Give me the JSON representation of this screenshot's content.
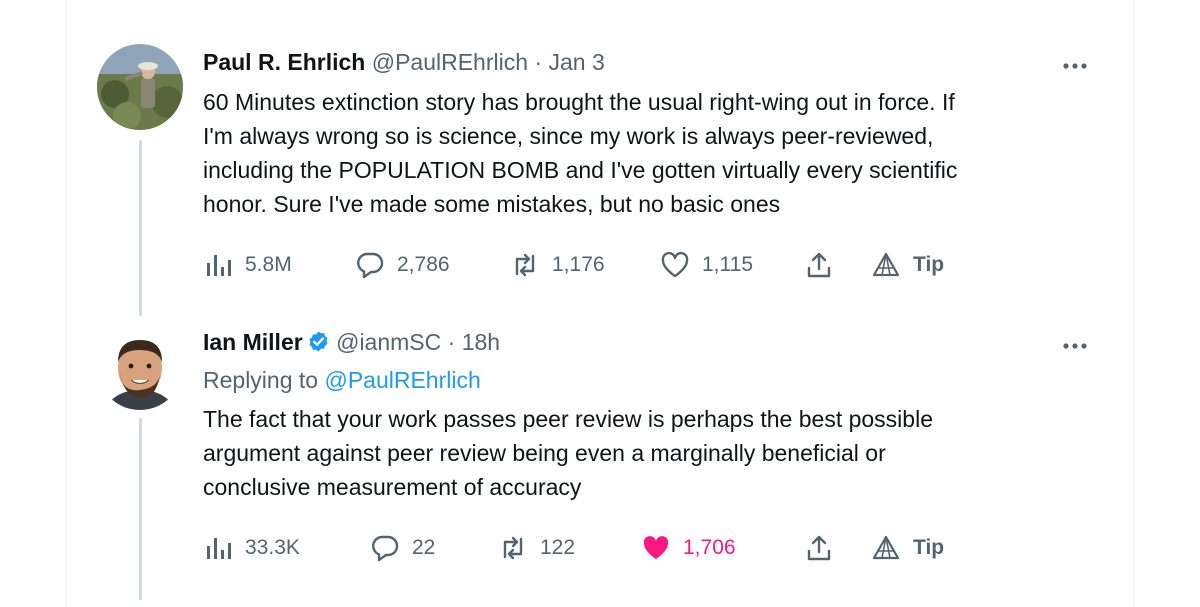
{
  "tweets": [
    {
      "author_name": "Paul R. Ehrlich",
      "handle": "@PaulREhrlich",
      "separator": "·",
      "time": "Jan 3",
      "more_icon": "more-horizontal-icon",
      "text_lines": [
        "60 Minutes extinction story has brought the usual right-wing out in force.  If",
        "I'm always wrong so is science, since my work is always peer-reviewed,",
        "including the POPULATION BOMB and I've gotten virtually every scientific",
        "honor. Sure I've made some mistakes, but no basic ones"
      ],
      "stats": {
        "views": "5.8M",
        "replies": "2,786",
        "retweets": "1,176",
        "likes": "1,115",
        "tip": "Tip"
      },
      "liked": false
    },
    {
      "author_name": "Ian Miller",
      "verified": true,
      "handle": "@ianmSC",
      "separator": "·",
      "time": "18h",
      "more_icon": "more-horizontal-icon",
      "replying_prefix": "Replying to",
      "replying_handle": "@PaulREhrlich",
      "text_lines": [
        "The fact that your work passes peer review is perhaps the best possible",
        "argument against peer review being even a marginally beneficial or",
        "conclusive measurement of accuracy"
      ],
      "stats": {
        "views": "33.3K",
        "replies": "22",
        "retweets": "122",
        "likes": "1,706",
        "tip": "Tip"
      },
      "liked": true
    }
  ],
  "colors": {
    "text": "#0f1419",
    "secondary": "#536471",
    "link": "#1d9bf0",
    "like": "#f91880",
    "verified": "#1d9bf0",
    "thread_line": "#cfd9de"
  }
}
